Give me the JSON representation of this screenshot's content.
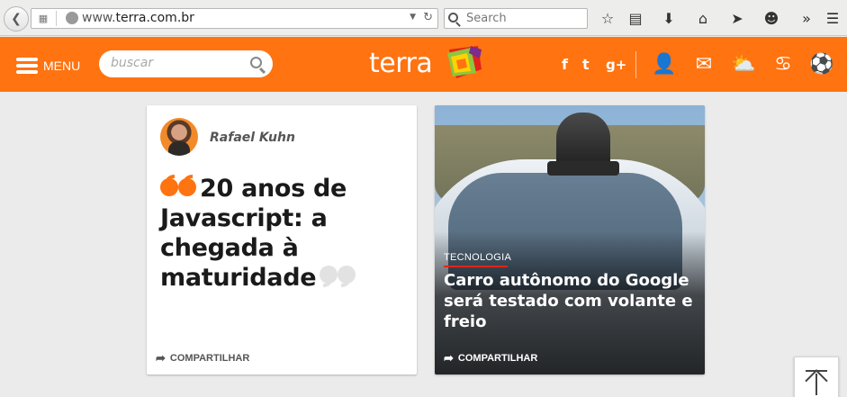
{
  "browser": {
    "url_prefix": "www.",
    "url_host": "terra.com.br",
    "search_placeholder": "Search",
    "icons": [
      "back-icon",
      "page-info-icon",
      "globe-icon",
      "dropdown-icon",
      "reload-icon",
      "search-icon",
      "bookmark-star-icon",
      "reading-list-icon",
      "download-icon",
      "home-icon",
      "send-icon",
      "smiley-icon",
      "overflow-icon",
      "hamburger-menu-icon"
    ]
  },
  "header": {
    "menu_label": "MENU",
    "search_placeholder": "buscar",
    "brand": "terra",
    "social": {
      "facebook": "f",
      "twitter": "t",
      "google_plus": "g+"
    },
    "colors": {
      "background": "#ff7311",
      "text": "#ffffff"
    }
  },
  "cards": {
    "opinion": {
      "author": "Rafael Kuhn",
      "title": "20 anos de Javascript: a chegada à maturidade",
      "share_label": "COMPARTILHAR"
    },
    "news": {
      "category": "TECNOLOGIA",
      "headline": "Carro autônomo do Google será testado com volante e freio",
      "share_label": "COMPARTILHAR"
    }
  }
}
